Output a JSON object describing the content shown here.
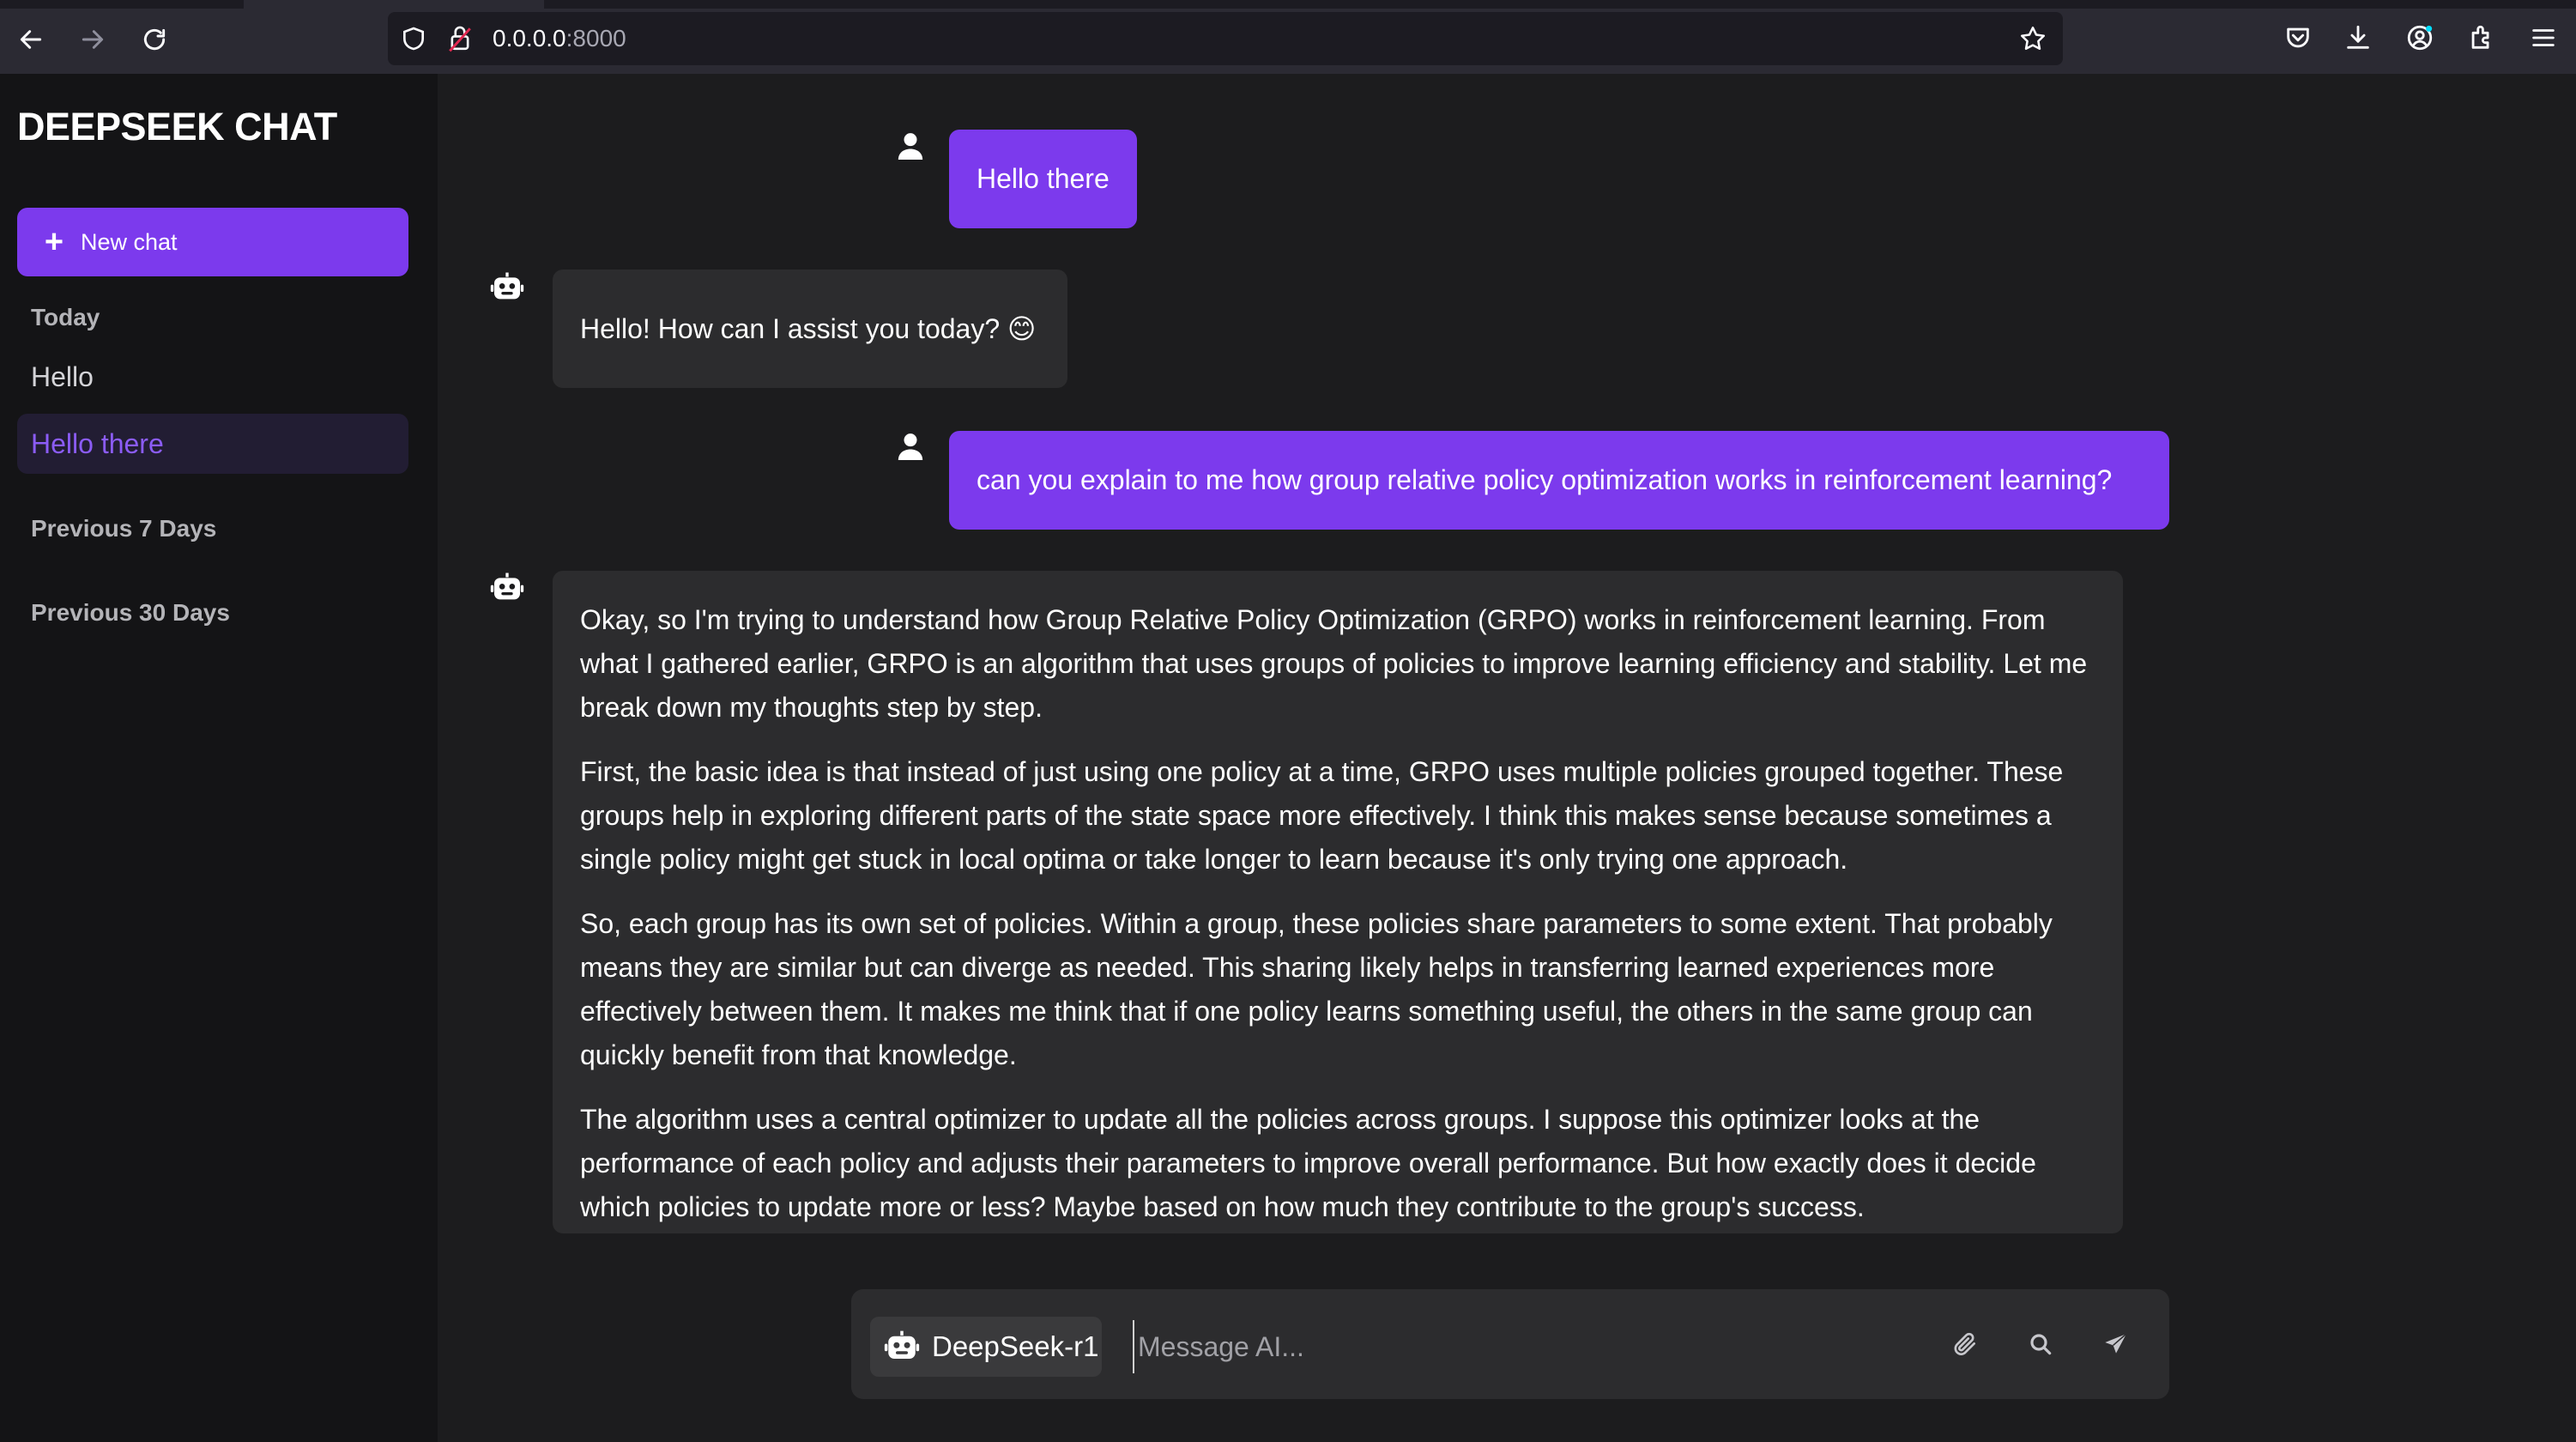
{
  "browser": {
    "url_host": "0.0.0.0",
    "url_port": ":8000"
  },
  "sidebar": {
    "title": "DEEPSEEK CHAT",
    "new_chat_label": "New chat",
    "sections": {
      "today": "Today",
      "previous_7": "Previous 7 Days",
      "previous_30": "Previous 30 Days"
    },
    "chats": [
      {
        "label": "Hello",
        "active": false
      },
      {
        "label": "Hello there",
        "active": true
      }
    ]
  },
  "conversation": {
    "messages": [
      {
        "role": "user",
        "text": "Hello there"
      },
      {
        "role": "assistant",
        "text": "Hello! How can I assist you today? 😊"
      },
      {
        "role": "user",
        "text": "can you explain to me how group relative policy optimization works in reinforcement learning?"
      },
      {
        "role": "assistant",
        "paragraphs": [
          "Okay, so I'm trying to understand how Group Relative Policy Optimization (GRPO) works in reinforcement learning. From what I gathered earlier, GRPO is an algorithm that uses groups of policies to improve learning efficiency and stability. Let me break down my thoughts step by step.",
          "First, the basic idea is that instead of just using one policy at a time, GRPO uses multiple policies grouped together. These groups help in exploring different parts of the state space more effectively. I think this makes sense because sometimes a single policy might get stuck in local optima or take longer to learn because it's only trying one approach.",
          "So, each group has its own set of policies. Within a group, these policies share parameters to some extent. That probably means they are similar but can diverge as needed. This sharing likely helps in transferring learned experiences more effectively between them. It makes me think that if one policy learns something useful, the others in the same group can quickly benefit from that knowledge.",
          "The algorithm uses a central optimizer to update all the policies across groups. I suppose this optimizer looks at the performance of each policy and adjusts their parameters to improve overall performance. But how exactly does it decide which policies to update more or less? Maybe based on how much they contribute to the group's success."
        ]
      }
    ]
  },
  "composer": {
    "model_label": "DeepSeek-r1",
    "placeholder": "Message AI..."
  },
  "colors": {
    "accent": "#7c3aed",
    "active_item_text": "#8b5cf6",
    "sidebar_bg": "#141416",
    "main_bg": "#1c1c1e",
    "bubble_ai_bg": "#2c2c2e"
  },
  "icons": {
    "nav": [
      "back-arrow-icon",
      "forward-arrow-icon",
      "reload-icon"
    ],
    "url": [
      "shield-icon",
      "lock-icon",
      "bookmark-star-icon"
    ],
    "toolbar": [
      "pocket-icon",
      "download-icon",
      "account-icon",
      "extensions-icon",
      "menu-icon"
    ],
    "chat": [
      "user-icon",
      "robot-icon"
    ],
    "composer": [
      "robot-icon",
      "paperclip-icon",
      "search-icon",
      "send-icon"
    ]
  }
}
